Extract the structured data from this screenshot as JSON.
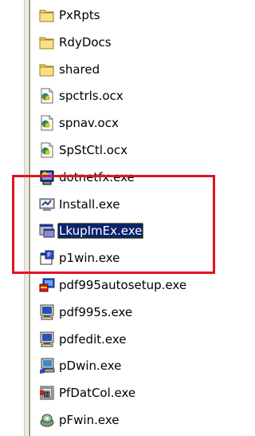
{
  "explorer": {
    "items": [
      {
        "name": "PxRpts",
        "type": "folder",
        "icon": "folder-icon"
      },
      {
        "name": "RdyDocs",
        "type": "folder",
        "icon": "folder-icon"
      },
      {
        "name": "shared",
        "type": "folder",
        "icon": "folder-icon"
      },
      {
        "name": "spctrls.ocx",
        "type": "ocx",
        "icon": "activex-control-icon"
      },
      {
        "name": "spnav.ocx",
        "type": "ocx",
        "icon": "activex-control-icon"
      },
      {
        "name": "SpStCtl.ocx",
        "type": "ocx",
        "icon": "activex-control-icon"
      },
      {
        "name": "dotnetfx.exe",
        "type": "exe",
        "icon": "installer-icon"
      },
      {
        "name": "Install.exe",
        "type": "exe",
        "icon": "install-icon"
      },
      {
        "name": "LkupImEx.exe",
        "type": "exe",
        "icon": "app-window-icon",
        "selected": true
      },
      {
        "name": "p1win.exe",
        "type": "exe",
        "icon": "p1win-icon"
      },
      {
        "name": "pdf995autosetup.exe",
        "type": "exe",
        "icon": "setup-icon"
      },
      {
        "name": "pdf995s.exe",
        "type": "exe",
        "icon": "monitor-icon"
      },
      {
        "name": "pdfedit.exe",
        "type": "exe",
        "icon": "monitor-icon"
      },
      {
        "name": "pDwin.exe",
        "type": "exe",
        "icon": "computer-icon"
      },
      {
        "name": "PfDatCol.exe",
        "type": "exe",
        "icon": "data-collector-icon"
      },
      {
        "name": "pFwin.exe",
        "type": "exe",
        "icon": "network-icon"
      }
    ]
  },
  "annotation": {
    "color": "#e0141e"
  },
  "colors": {
    "selection": "#0a246a",
    "folder": "#f5d36b"
  }
}
